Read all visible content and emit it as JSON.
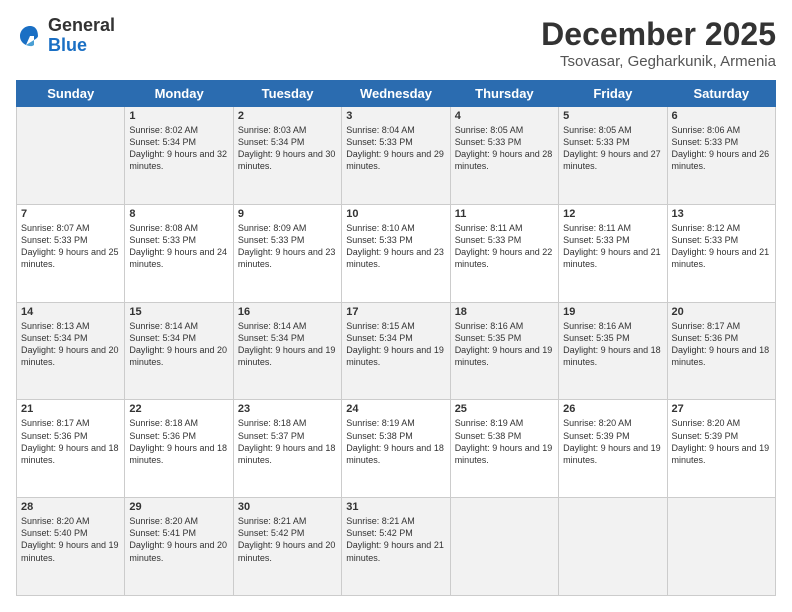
{
  "logo": {
    "general": "General",
    "blue": "Blue"
  },
  "title": "December 2025",
  "subtitle": "Tsovasar, Gegharkunik, Armenia",
  "weekdays": [
    "Sunday",
    "Monday",
    "Tuesday",
    "Wednesday",
    "Thursday",
    "Friday",
    "Saturday"
  ],
  "weeks": [
    [
      {
        "day": "",
        "sunrise": "",
        "sunset": "",
        "daylight": ""
      },
      {
        "day": "1",
        "sunrise": "8:02 AM",
        "sunset": "5:34 PM",
        "daylight": "9 hours and 32 minutes."
      },
      {
        "day": "2",
        "sunrise": "8:03 AM",
        "sunset": "5:34 PM",
        "daylight": "9 hours and 30 minutes."
      },
      {
        "day": "3",
        "sunrise": "8:04 AM",
        "sunset": "5:33 PM",
        "daylight": "9 hours and 29 minutes."
      },
      {
        "day": "4",
        "sunrise": "8:05 AM",
        "sunset": "5:33 PM",
        "daylight": "9 hours and 28 minutes."
      },
      {
        "day": "5",
        "sunrise": "8:05 AM",
        "sunset": "5:33 PM",
        "daylight": "9 hours and 27 minutes."
      },
      {
        "day": "6",
        "sunrise": "8:06 AM",
        "sunset": "5:33 PM",
        "daylight": "9 hours and 26 minutes."
      }
    ],
    [
      {
        "day": "7",
        "sunrise": "8:07 AM",
        "sunset": "5:33 PM",
        "daylight": "9 hours and 25 minutes."
      },
      {
        "day": "8",
        "sunrise": "8:08 AM",
        "sunset": "5:33 PM",
        "daylight": "9 hours and 24 minutes."
      },
      {
        "day": "9",
        "sunrise": "8:09 AM",
        "sunset": "5:33 PM",
        "daylight": "9 hours and 23 minutes."
      },
      {
        "day": "10",
        "sunrise": "8:10 AM",
        "sunset": "5:33 PM",
        "daylight": "9 hours and 23 minutes."
      },
      {
        "day": "11",
        "sunrise": "8:11 AM",
        "sunset": "5:33 PM",
        "daylight": "9 hours and 22 minutes."
      },
      {
        "day": "12",
        "sunrise": "8:11 AM",
        "sunset": "5:33 PM",
        "daylight": "9 hours and 21 minutes."
      },
      {
        "day": "13",
        "sunrise": "8:12 AM",
        "sunset": "5:33 PM",
        "daylight": "9 hours and 21 minutes."
      }
    ],
    [
      {
        "day": "14",
        "sunrise": "8:13 AM",
        "sunset": "5:34 PM",
        "daylight": "9 hours and 20 minutes."
      },
      {
        "day": "15",
        "sunrise": "8:14 AM",
        "sunset": "5:34 PM",
        "daylight": "9 hours and 20 minutes."
      },
      {
        "day": "16",
        "sunrise": "8:14 AM",
        "sunset": "5:34 PM",
        "daylight": "9 hours and 19 minutes."
      },
      {
        "day": "17",
        "sunrise": "8:15 AM",
        "sunset": "5:34 PM",
        "daylight": "9 hours and 19 minutes."
      },
      {
        "day": "18",
        "sunrise": "8:16 AM",
        "sunset": "5:35 PM",
        "daylight": "9 hours and 19 minutes."
      },
      {
        "day": "19",
        "sunrise": "8:16 AM",
        "sunset": "5:35 PM",
        "daylight": "9 hours and 18 minutes."
      },
      {
        "day": "20",
        "sunrise": "8:17 AM",
        "sunset": "5:36 PM",
        "daylight": "9 hours and 18 minutes."
      }
    ],
    [
      {
        "day": "21",
        "sunrise": "8:17 AM",
        "sunset": "5:36 PM",
        "daylight": "9 hours and 18 minutes."
      },
      {
        "day": "22",
        "sunrise": "8:18 AM",
        "sunset": "5:36 PM",
        "daylight": "9 hours and 18 minutes."
      },
      {
        "day": "23",
        "sunrise": "8:18 AM",
        "sunset": "5:37 PM",
        "daylight": "9 hours and 18 minutes."
      },
      {
        "day": "24",
        "sunrise": "8:19 AM",
        "sunset": "5:38 PM",
        "daylight": "9 hours and 18 minutes."
      },
      {
        "day": "25",
        "sunrise": "8:19 AM",
        "sunset": "5:38 PM",
        "daylight": "9 hours and 19 minutes."
      },
      {
        "day": "26",
        "sunrise": "8:20 AM",
        "sunset": "5:39 PM",
        "daylight": "9 hours and 19 minutes."
      },
      {
        "day": "27",
        "sunrise": "8:20 AM",
        "sunset": "5:39 PM",
        "daylight": "9 hours and 19 minutes."
      }
    ],
    [
      {
        "day": "28",
        "sunrise": "8:20 AM",
        "sunset": "5:40 PM",
        "daylight": "9 hours and 19 minutes."
      },
      {
        "day": "29",
        "sunrise": "8:20 AM",
        "sunset": "5:41 PM",
        "daylight": "9 hours and 20 minutes."
      },
      {
        "day": "30",
        "sunrise": "8:21 AM",
        "sunset": "5:42 PM",
        "daylight": "9 hours and 20 minutes."
      },
      {
        "day": "31",
        "sunrise": "8:21 AM",
        "sunset": "5:42 PM",
        "daylight": "9 hours and 21 minutes."
      },
      {
        "day": "",
        "sunrise": "",
        "sunset": "",
        "daylight": ""
      },
      {
        "day": "",
        "sunrise": "",
        "sunset": "",
        "daylight": ""
      },
      {
        "day": "",
        "sunrise": "",
        "sunset": "",
        "daylight": ""
      }
    ]
  ]
}
